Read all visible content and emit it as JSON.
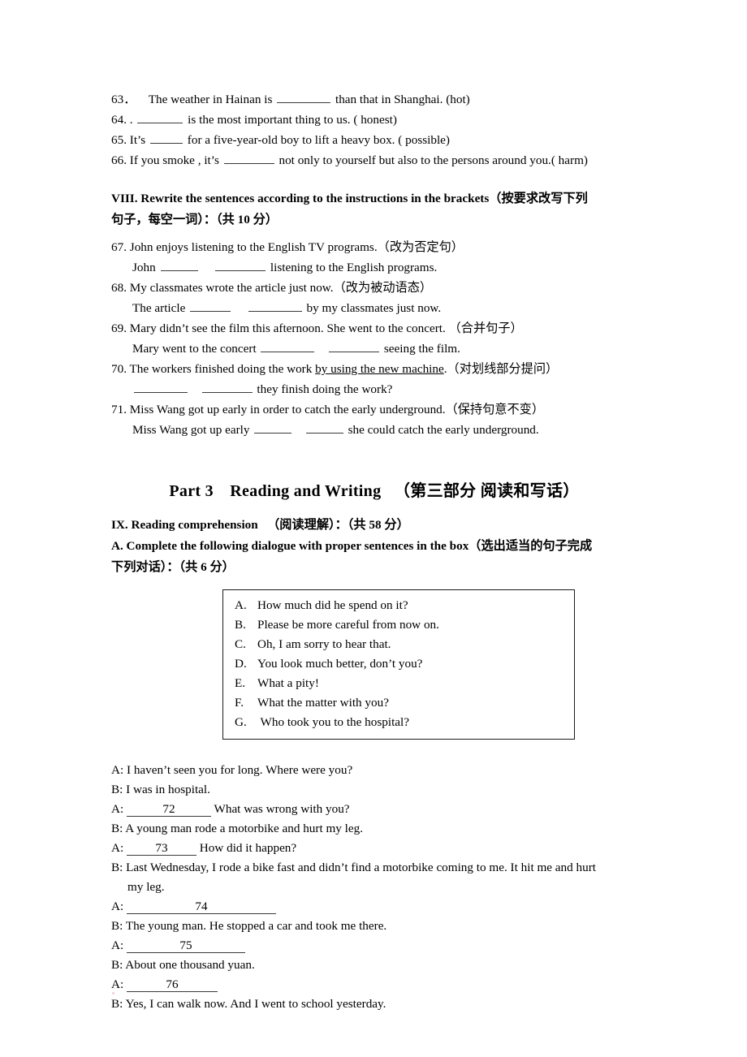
{
  "fill_in_blanks": {
    "items": [
      {
        "num": "63．",
        "pre": "The weather in Hainan is",
        "mid": "than that in Shanghai. (hot)"
      },
      {
        "num": "64. .",
        "pre": "",
        "mid": "is the most important thing to us. ( honest)"
      },
      {
        "num": "65.",
        "pre": "It’s",
        "mid": "for a five-year-old boy to lift a heavy box. ( possible)"
      },
      {
        "num": "66.",
        "pre": "If you smoke , it’s",
        "mid": "not only to yourself but also to the persons around you.( harm)"
      }
    ]
  },
  "section_viii": {
    "heading_line1": "VIII. Rewrite the sentences according to the instructions in the brackets（按要求改写下列",
    "heading_line2": "句子，每空一词）：（共 10 分）",
    "items": [
      {
        "num": "67.",
        "prompt": "John enjoys listening to the English TV programs.（改为否定句）",
        "answer_pre": "John",
        "answer_post": "listening to the English programs."
      },
      {
        "num": "68.",
        "prompt": "My classmates wrote the article just now.（改为被动语态）",
        "answer_pre": "The article",
        "answer_post": "by my classmates just now."
      },
      {
        "num": "69.",
        "prompt": "Mary didn’t see the film this afternoon. She went to the concert. （合并句子）",
        "answer_pre": "Mary went to the concert",
        "answer_post": "seeing the film."
      },
      {
        "num": "70.",
        "prompt_pre": "The workers finished doing the work ",
        "prompt_underlined": "by using the new machine",
        "prompt_post": ".（对划线部分提问）",
        "answer_pre": "",
        "answer_post": "they finish doing the work?"
      },
      {
        "num": "71.",
        "prompt": "Miss Wang got up early in order to catch the early underground.（保持句意不变）",
        "answer_pre": "Miss Wang got up early",
        "answer_post": "she could catch the early underground."
      }
    ]
  },
  "part3": {
    "title": "Part 3 Reading and Writing  （第三部分 阅读和写话）",
    "section_ix_heading": "IX. Reading comprehension  （阅读理解）：（共 58 分）",
    "task_a_line1": "A. Complete the following dialogue with proper sentences in the box（选出适当的句子完成",
    "task_a_line2": "下列对话）：（共 6 分）"
  },
  "options_box": {
    "items": [
      {
        "letter": "A.",
        "text": "How much did he spend on it?"
      },
      {
        "letter": "B.",
        "text": "Please be more careful from now on."
      },
      {
        "letter": "C.",
        "text": "Oh, I am sorry to hear that."
      },
      {
        "letter": "D.",
        "text": "You look much better, don’t you?"
      },
      {
        "letter": "E.",
        "text": "What a pity!"
      },
      {
        "letter": "F.",
        "text": "What the matter with you?"
      },
      {
        "letter": "G.",
        "text": " Who took you to the hospital?"
      }
    ]
  },
  "dialogue": {
    "l1": "A: I haven’t seen you for long. Where were you?",
    "l2": "B: I was in hospital.",
    "l3_speaker": "A:",
    "l3_blank": "72",
    "l3_after": "What was wrong with you?",
    "l4": "B: A young man rode a motorbike and hurt my leg.",
    "l5_speaker": "A:",
    "l5_blank": "73",
    "l5_after": "How did it happen?",
    "l6a": "B: Last Wednesday, I rode a bike fast and didn’t find a motorbike coming to me. It hit me and hurt",
    "l6b": "my leg.",
    "l7_speaker": "A:",
    "l7_blank": "74",
    "l8": "B: The young man. He stopped a car and took me there.",
    "l9_speaker": "A:",
    "l9_blank": "75",
    "l10": "B: About one thousand yuan.",
    "l11_speaker": "A:",
    "l11_blank": "76",
    "l12": "B: Yes, I can walk now. And I went to school yesterday."
  }
}
